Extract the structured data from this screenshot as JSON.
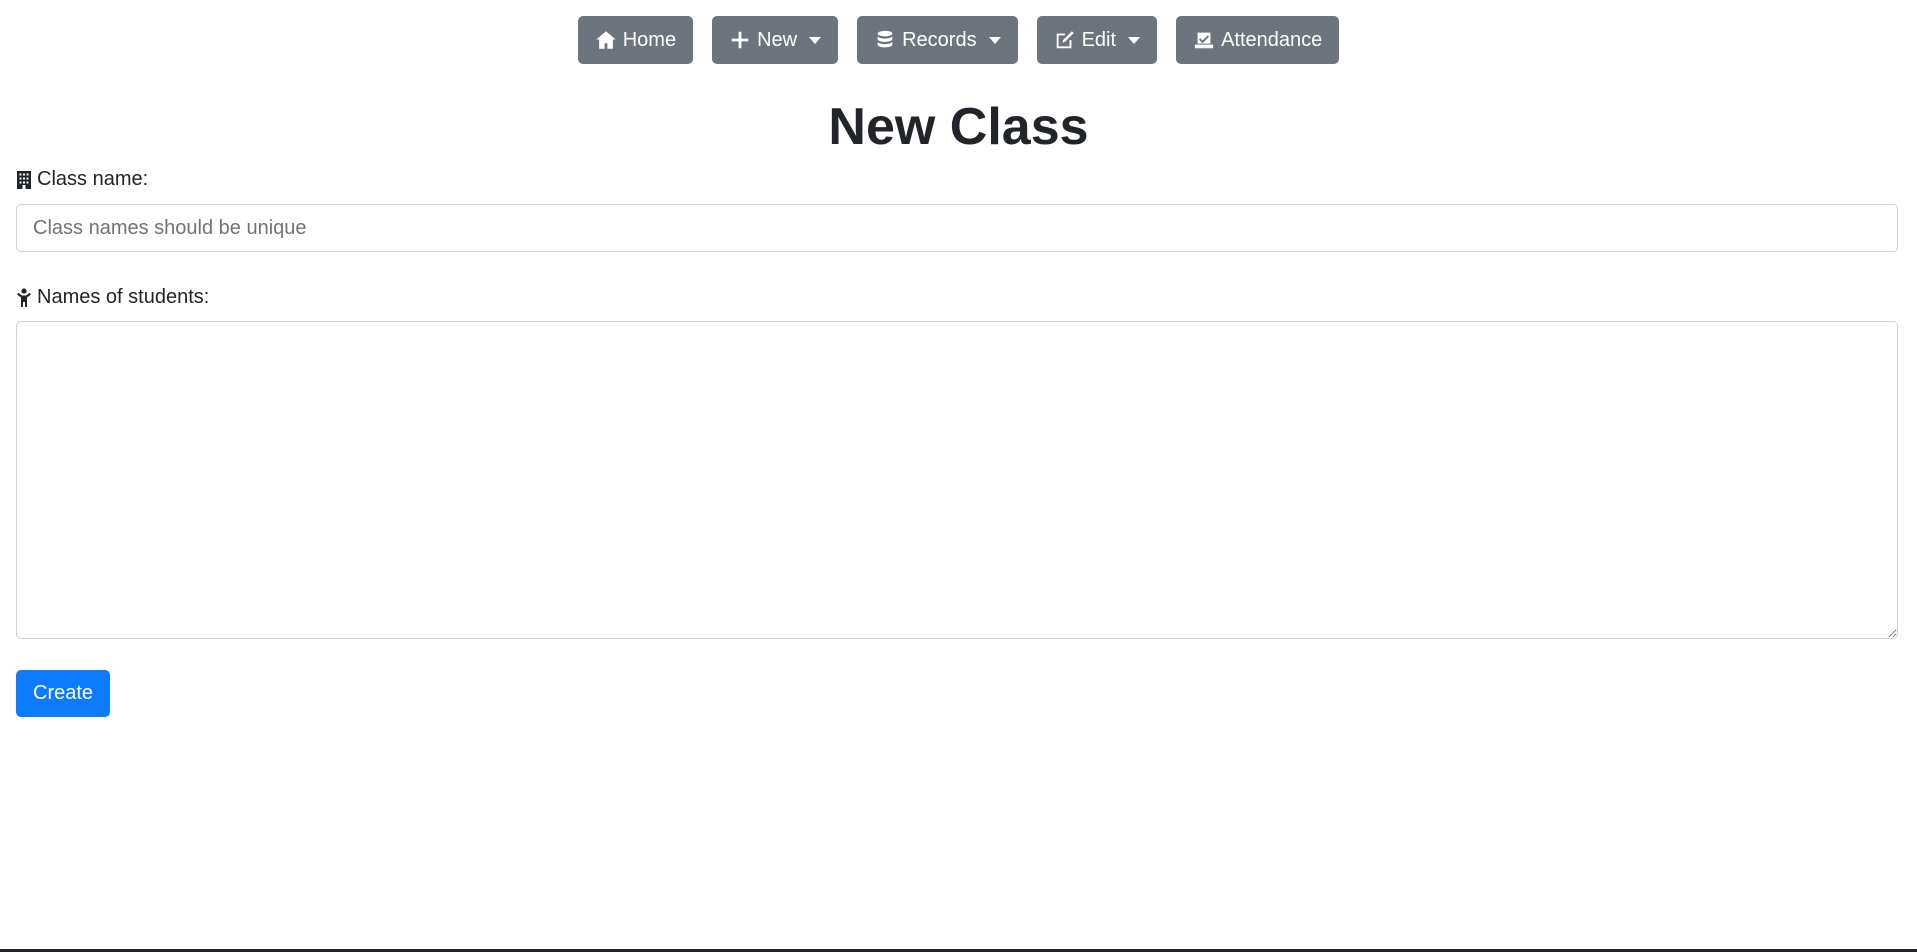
{
  "nav": {
    "home_label": "Home",
    "new_label": "New",
    "records_label": "Records",
    "edit_label": "Edit",
    "attendance_label": "Attendance"
  },
  "page": {
    "title": "New Class"
  },
  "form": {
    "class_name_label": "Class name:",
    "class_name_value": "",
    "class_name_placeholder": "Class names should be unique",
    "students_label": "Names of students:",
    "students_value": "",
    "create_label": "Create"
  },
  "icons": {
    "home": "home-icon",
    "new": "plus-icon",
    "records": "database-icon",
    "edit": "edit-icon",
    "attendance": "attendance-check-icon",
    "class": "building-icon",
    "students": "child-icon"
  },
  "colors": {
    "nav_button": "#6c757d",
    "primary": "#0d7bff",
    "text": "#212529"
  }
}
